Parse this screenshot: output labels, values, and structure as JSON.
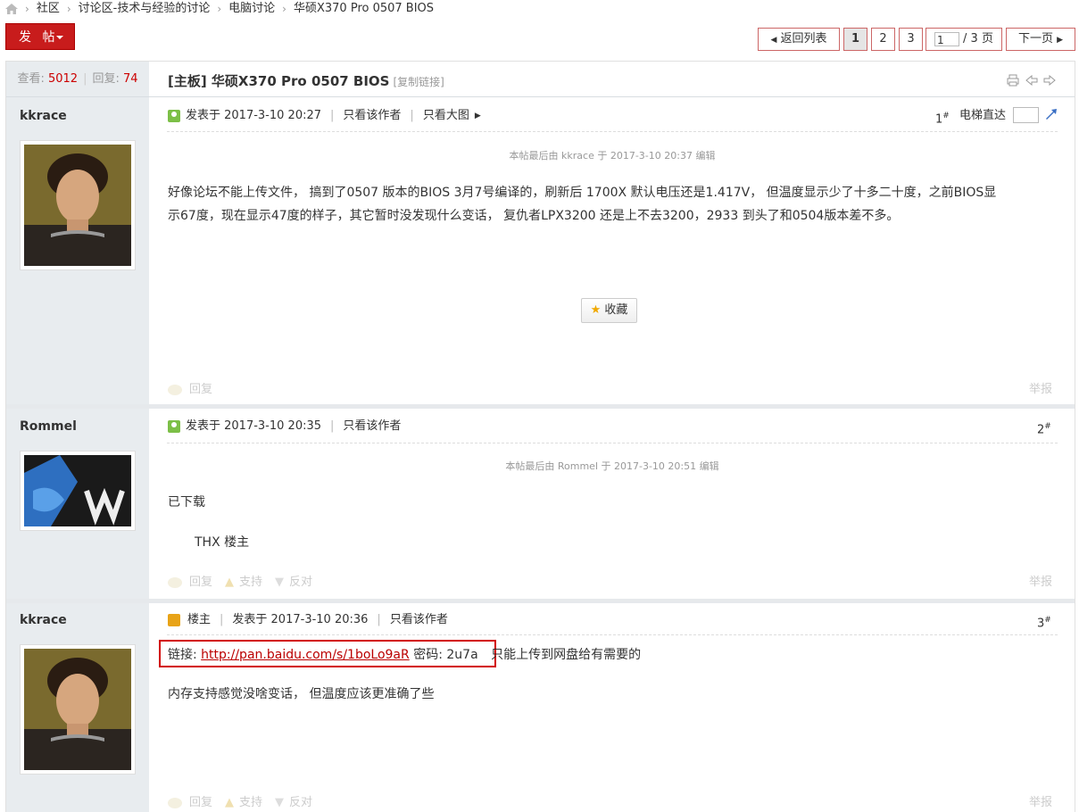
{
  "breadcrumb": {
    "items": [
      "社区",
      "讨论区-技术与经验的讨论",
      "电脑讨论",
      "华硕X370 Pro 0507 BIOS"
    ]
  },
  "toolbar": {
    "post_label": "发 帖"
  },
  "pager": {
    "back_label": "返回列表",
    "pages": [
      "1",
      "2",
      "3"
    ],
    "current_input": "1",
    "total_label": "/ 3 页",
    "next_label": "下一页"
  },
  "stats": {
    "views_label": "查看:",
    "views": "5012",
    "replies_label": "回复:",
    "replies": "74"
  },
  "thread": {
    "title": "[主板] 华硕X370 Pro 0507 BIOS",
    "copy_link": "[复制链接]"
  },
  "posts": [
    {
      "author": "kkrace",
      "posted": "发表于 2017-3-10 20:27",
      "only_author": "只看该作者",
      "big_image": "只看大图",
      "floor": "1",
      "jump_label": "电梯直达",
      "edit_note": "本帖最后由 kkrace 于 2017-3-10 20:37 编辑",
      "body_line1": "好像论坛不能上传文件， 搞到了0507 版本的BIOS  3月7号编译的，刷新后 1700X 默认电压还是1.417V， 但温度显示少了十多二十度，之前BIOS显",
      "body_line2": "示67度，现在显示47度的样子，其它暂时没发现什么变话， 复仇者LPX3200  还是上不去3200，2933 到头了和0504版本差不多。",
      "favorite": "收藏",
      "reply": "回复",
      "report": "举报"
    },
    {
      "author": "Rommel",
      "posted": "发表于 2017-3-10 20:35",
      "only_author": "只看该作者",
      "floor": "2",
      "edit_note": "本帖最后由 Rommel 于 2017-3-10 20:51 编辑",
      "body_line1": "已下载",
      "body_line2": "THX 楼主",
      "reply": "回复",
      "support": "支持",
      "oppose": "反对",
      "report": "举报"
    },
    {
      "author": "kkrace",
      "owner_badge": "楼主",
      "posted": "发表于 2017-3-10 20:36",
      "only_author": "只看该作者",
      "floor": "3",
      "link_label": "链接:",
      "link_url": "http://pan.baidu.com/s/1boLo9aR",
      "pwd_label": "密码:",
      "pwd": "2u7a",
      "link_note": "只能上传到网盘给有需要的",
      "body_line2": "内存支持感觉没啥变话， 但温度应该更准确了些",
      "reply": "回复",
      "support": "支持",
      "oppose": "反对",
      "report": "举报"
    }
  ],
  "colors": {
    "accent": "#c81c1c",
    "link": "#bb0000",
    "sidebar": "#e8ecef",
    "highlight_box": "#d20000"
  },
  "icons": [
    "home-icon",
    "user-icon",
    "owner-icon",
    "print-icon",
    "prev-thread-icon",
    "next-thread-icon",
    "jump-icon",
    "star-icon",
    "reply-icon",
    "support-icon",
    "oppose-icon"
  ]
}
